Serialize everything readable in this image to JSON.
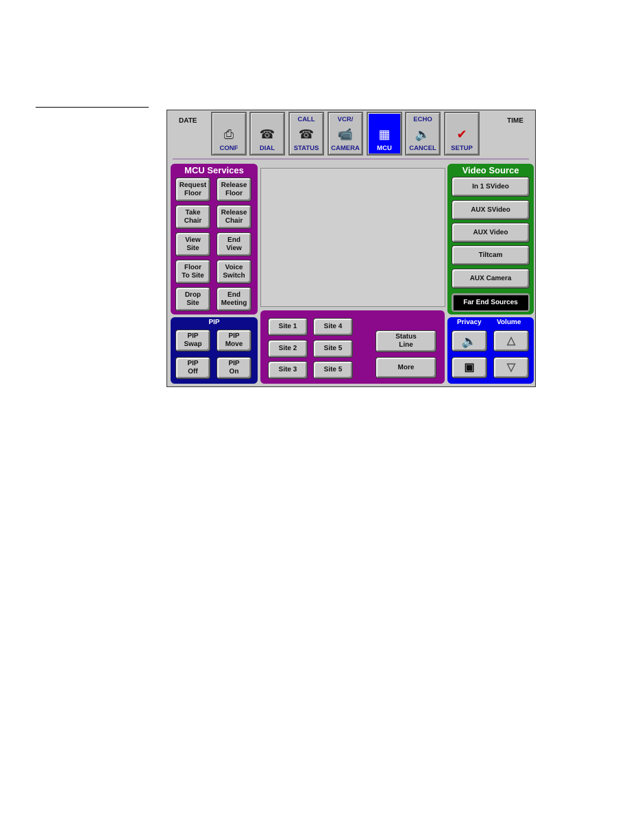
{
  "header": {
    "date_label": "DATE",
    "time_label": "TIME"
  },
  "tabs": [
    {
      "top": "",
      "label": "CONF",
      "icon": "conference-camera-icon"
    },
    {
      "top": "",
      "label": "DIAL",
      "icon": "telephone-icon"
    },
    {
      "top": "CALL",
      "label": "STATUS",
      "icon": "telephone-icon"
    },
    {
      "top": "VCR/",
      "label": "CAMERA",
      "icon": "video-camera-icon"
    },
    {
      "top": "",
      "label": "MCU",
      "icon": "multipoint-grid-icon",
      "active": true
    },
    {
      "top": "ECHO",
      "label": "CANCEL",
      "icon": "speaker-icon"
    },
    {
      "top": "",
      "label": "SETUP",
      "icon": "setup-checkmark-icon"
    }
  ],
  "mcu_services": {
    "title": "MCU Services",
    "buttons": [
      "Request\nFloor",
      "Release\nFloor",
      "Take\nChair",
      "Release\nChair",
      "View\nSite",
      "End\nView",
      "Floor\nTo Site",
      "Voice\nSwitch",
      "Drop\nSite",
      "End\nMeeting"
    ]
  },
  "pip": {
    "title": "PIP",
    "buttons": [
      "PIP\nSwap",
      "PIP\nMove",
      "PIP\nOff",
      "PIP\nOn"
    ]
  },
  "sites": {
    "buttons": [
      "Site 1",
      "Site 4",
      "Site 2",
      "Site 5",
      "Site 3",
      "Site 5"
    ],
    "status_line": "Status\nLine",
    "more": "More"
  },
  "video_source": {
    "title": "Video Source",
    "buttons": [
      "In 1 SVideo",
      "AUX SVideo",
      "AUX Video",
      "Tiltcam",
      "AUX Camera",
      "Far End Sources"
    ]
  },
  "controls": {
    "privacy_label": "Privacy",
    "volume_label": "Volume"
  },
  "colors": {
    "mcu_panel": "#8b0a8b",
    "pip_panel": "#0a0a8a",
    "video_panel": "#1a8a1a",
    "controls_panel": "#0000ee",
    "active_tab": "#0000ff"
  }
}
